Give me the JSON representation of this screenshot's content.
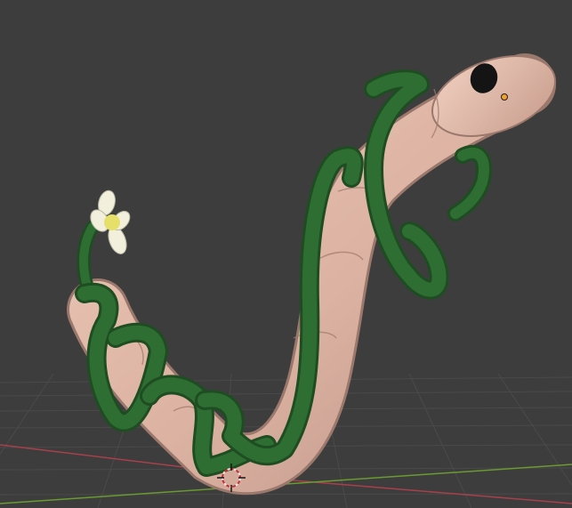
{
  "viewport": {
    "view": "3D Viewport",
    "background_color": "#3d3d3d",
    "grid_color": "#4a4a4a",
    "x_axis_color": "#a8404c",
    "y_axis_color": "#6a9a30"
  },
  "scene": {
    "objects": [
      {
        "name": "worm",
        "color": "#e0b8a8",
        "shade": "#c49686"
      },
      {
        "name": "vine",
        "color": "#2f6e33",
        "shade": "#1e4d22"
      },
      {
        "name": "flower",
        "color": "#f2f0dc",
        "center_color": "#e6e06a"
      }
    ],
    "eye_color": "#141414",
    "origin_color": "#f0a030"
  },
  "icons": {
    "cursor": "3d-cursor-icon",
    "origin": "object-origin-icon"
  }
}
